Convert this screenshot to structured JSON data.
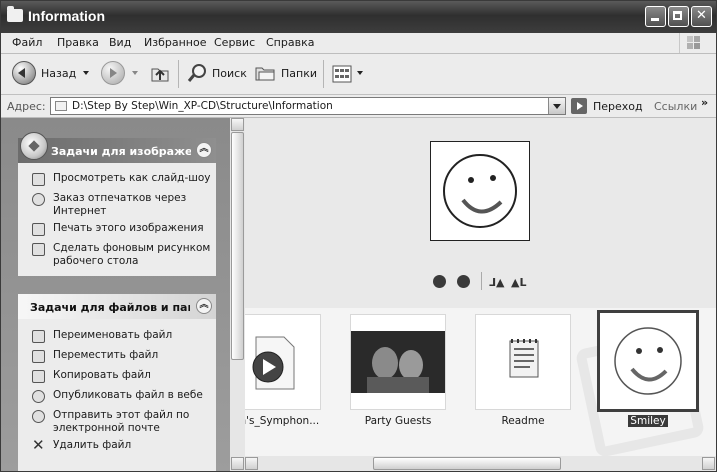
{
  "window": {
    "title": "Information"
  },
  "menu": [
    "Файл",
    "Правка",
    "Вид",
    "Избранное",
    "Сервис",
    "Справка"
  ],
  "toolbar": {
    "back": "Назад",
    "search": "Поиск",
    "folders": "Папки"
  },
  "address": {
    "label": "Адрес:",
    "value": "D:\\Step By Step\\Win_XP-CD\\Structure\\Information",
    "go": "Переход",
    "links": "Ссылки",
    "links_chevron": "»"
  },
  "image_tasks": {
    "title": "Задачи для изображений",
    "items": [
      "Просмотреть как слайд-шоу",
      "Заказ отпечатков через Интернет",
      "Печать этого изображения",
      "Сделать фоновым рисунком рабочего стола"
    ]
  },
  "file_tasks": {
    "title": "Задачи для файлов и папок",
    "items": [
      "Переименовать файл",
      "Переместить файл",
      "Копировать файл",
      "Опубликовать файл в вебе",
      "Отправить этот файл по электронной почте",
      "Удалить файл"
    ]
  },
  "collapse_symbol": "︽",
  "files": [
    {
      "label": "ven's_Symphon...",
      "kind": "media",
      "selected": false
    },
    {
      "label": "Party Guests",
      "kind": "photo",
      "selected": false
    },
    {
      "label": "Readme",
      "kind": "document",
      "selected": false
    },
    {
      "label": "Smiley",
      "kind": "image",
      "selected": true
    }
  ],
  "viewer_controls": {
    "rotate_cw": "⅃▲",
    "rotate_ccw": "▲L"
  },
  "colors": {
    "title_bar": "#3d3d3d",
    "selection": "#3a3a3a",
    "task_pane": "#9a9a9a"
  }
}
